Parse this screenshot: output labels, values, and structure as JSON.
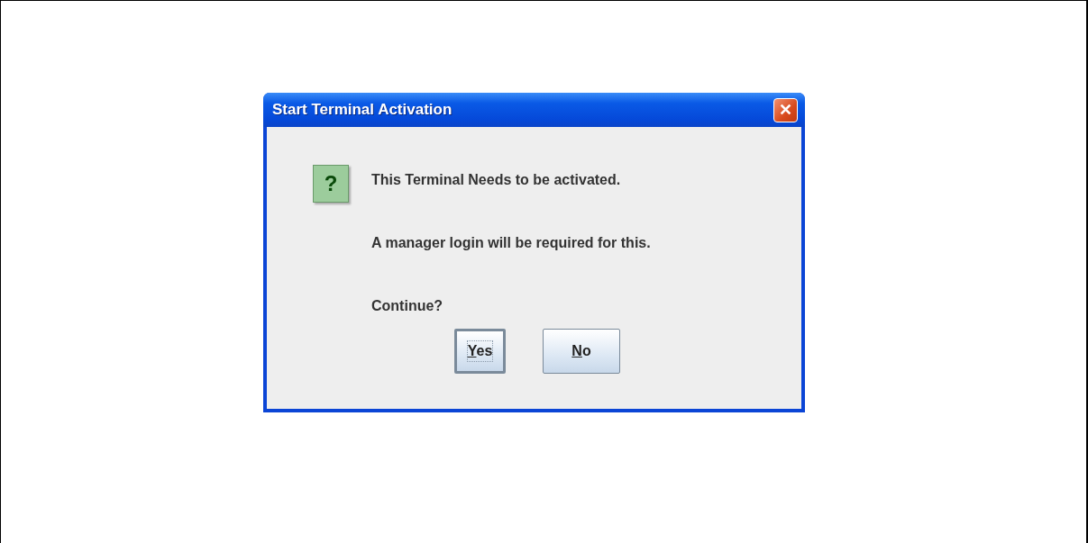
{
  "dialog": {
    "title": "Start Terminal Activation",
    "close": "✕",
    "icon": "?",
    "messages": [
      "This Terminal Needs to be activated.",
      "A manager login will be required for this.",
      "Continue?"
    ],
    "buttons": [
      {
        "label": "Yes",
        "focused": true
      },
      {
        "label": "No",
        "focused": false
      }
    ]
  }
}
